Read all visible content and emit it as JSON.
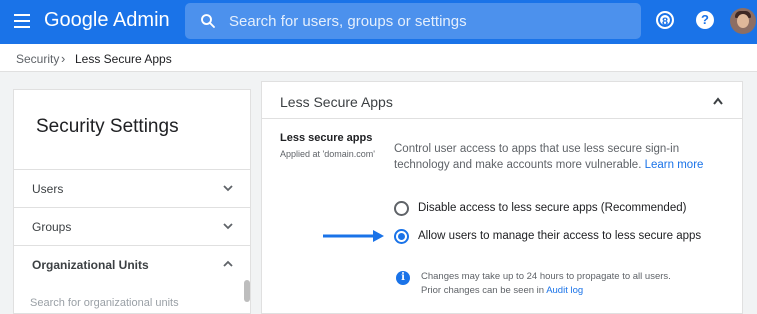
{
  "app": {
    "logo_text": "Google Admin"
  },
  "search": {
    "placeholder": "Search for users, groups or settings"
  },
  "header": {
    "badge_count": "8",
    "help_glyph": "?"
  },
  "breadcrumb": {
    "items": [
      "Security",
      "Less Secure Apps"
    ],
    "separator": "›"
  },
  "sidebar": {
    "title": "Security Settings",
    "items": [
      {
        "label": "Users",
        "expanded": false
      },
      {
        "label": "Groups",
        "expanded": false
      },
      {
        "label": "Organizational Units",
        "expanded": true
      }
    ],
    "ou_search_placeholder": "Search for organizational units"
  },
  "panel": {
    "title": "Less Secure Apps",
    "setting_name": "Less secure apps",
    "setting_scope": "Applied at 'domain.com'",
    "description": "Control user access to apps that use less secure sign-in technology and make accounts more vulnerable.",
    "learn_more": "Learn more",
    "options": [
      {
        "label": "Disable access to less secure apps (Recommended)",
        "selected": false
      },
      {
        "label": "Allow users to manage their access to less secure apps",
        "selected": true
      }
    ],
    "info_line1": "Changes may take up to 24 hours to propagate to all users.",
    "info_line2_prefix": "Prior changes can be seen in",
    "audit_log": "Audit log"
  },
  "colors": {
    "brand_blue": "#1a73e8",
    "text_dark": "#202124",
    "text_muted": "#5f6368"
  },
  "icons": [
    "menu-icon",
    "search-icon",
    "apps-badge-icon",
    "help-icon",
    "chevron-down-icon",
    "chevron-up-icon",
    "info-icon",
    "arrow-right-icon"
  ]
}
